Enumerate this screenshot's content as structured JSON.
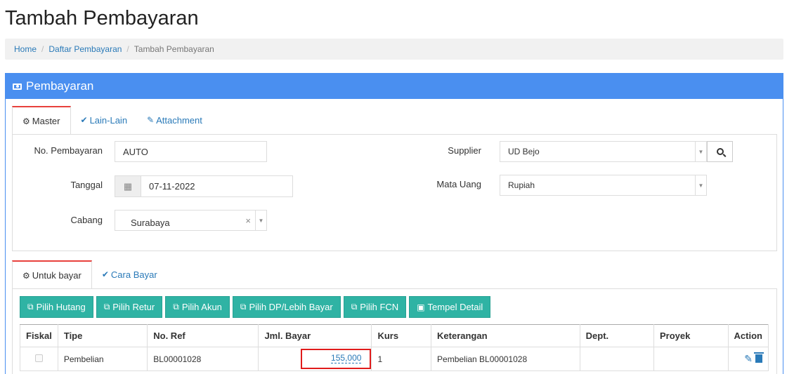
{
  "page_title": "Tambah Pembayaran",
  "breadcrumb": [
    "Home",
    "Daftar Pembayaran",
    "Tambah Pembayaran"
  ],
  "panel": {
    "title": "Pembayaran",
    "tabs": [
      "Master",
      "Lain-Lain",
      "Attachment"
    ],
    "form": {
      "no_pembayaran": {
        "label": "No. Pembayaran",
        "value": "AUTO"
      },
      "tanggal": {
        "label": "Tanggal",
        "value": "07-11-2022"
      },
      "cabang": {
        "label": "Cabang",
        "value": "Surabaya"
      },
      "supplier": {
        "label": "Supplier",
        "value": "UD Bejo"
      },
      "mata_uang": {
        "label": "Mata Uang",
        "value": "Rupiah"
      }
    },
    "sub_tabs": [
      "Untuk bayar",
      "Cara Bayar"
    ],
    "buttons": [
      "Pilih Hutang",
      "Pilih Retur",
      "Pilih Akun",
      "Pilih DP/Lebih Bayar",
      "Pilih FCN",
      "Tempel Detail"
    ],
    "table": {
      "columns": [
        "Fiskal",
        "Tipe",
        "No. Ref",
        "Jml. Bayar",
        "Kurs",
        "Keterangan",
        "Dept.",
        "Proyek",
        "Action"
      ],
      "rows": [
        {
          "tipe": "Pembelian",
          "no_ref": "BL00001028",
          "jml_bayar": "155,000",
          "kurs": "1",
          "keterangan": "Pembelian BL00001028",
          "dept": "",
          "proyek": ""
        }
      ]
    }
  },
  "icons": {
    "panel": "money-icon",
    "tab_master": "gears-icon",
    "tab_lain": "check-circle-icon",
    "tab_attachment": "paperclip-icon",
    "buttons": "copy-icon",
    "tempel": "paste-icon",
    "actions": [
      "pencil-icon",
      "trash-icon"
    ]
  },
  "colors": {
    "primary": "#4a8ff0",
    "button": "#2fb3a4",
    "link": "#2a7ab8",
    "tab_accent": "#e8413c",
    "highlight": "#e01b1b"
  }
}
